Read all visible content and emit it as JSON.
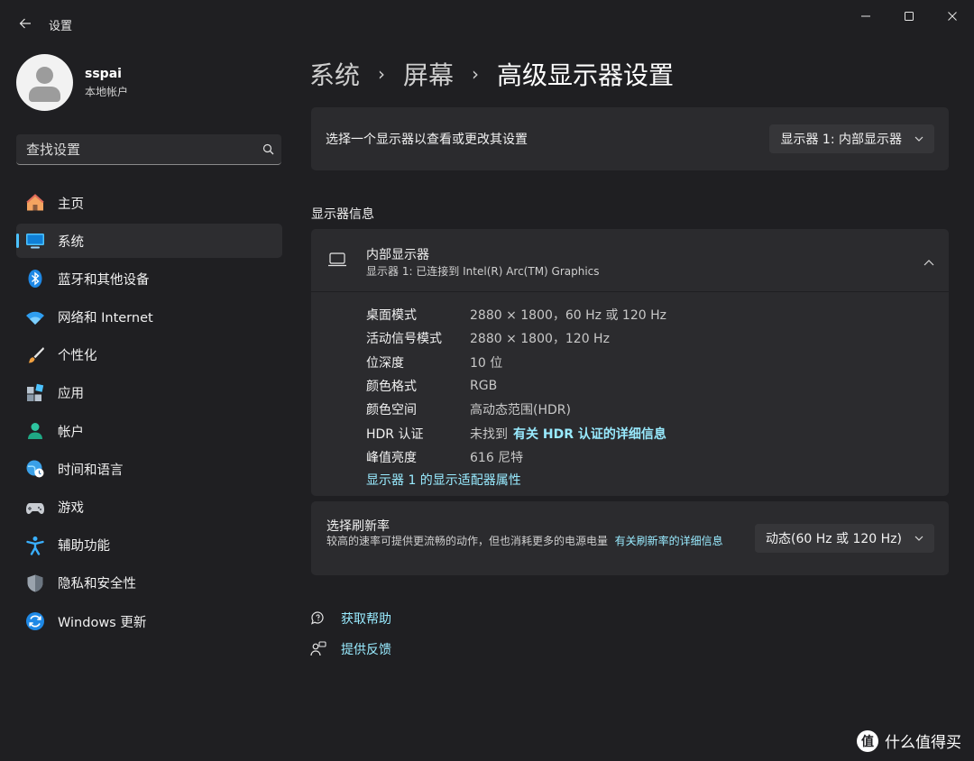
{
  "window": {
    "title": "设置"
  },
  "profile": {
    "name": "sspai",
    "account_type": "本地帐户"
  },
  "search": {
    "placeholder": "查找设置"
  },
  "sidebar": {
    "items": [
      {
        "label": "主页",
        "icon": "home-icon",
        "active": false
      },
      {
        "label": "系统",
        "icon": "system-icon",
        "active": true
      },
      {
        "label": "蓝牙和其他设备",
        "icon": "bluetooth-icon",
        "active": false
      },
      {
        "label": "网络和 Internet",
        "icon": "wifi-icon",
        "active": false
      },
      {
        "label": "个性化",
        "icon": "brush-icon",
        "active": false
      },
      {
        "label": "应用",
        "icon": "apps-icon",
        "active": false
      },
      {
        "label": "帐户",
        "icon": "account-icon",
        "active": false
      },
      {
        "label": "时间和语言",
        "icon": "globe-clock-icon",
        "active": false
      },
      {
        "label": "游戏",
        "icon": "gamepad-icon",
        "active": false
      },
      {
        "label": "辅助功能",
        "icon": "accessibility-icon",
        "active": false
      },
      {
        "label": "隐私和安全性",
        "icon": "shield-icon",
        "active": false
      },
      {
        "label": "Windows 更新",
        "icon": "update-icon",
        "active": false
      }
    ]
  },
  "breadcrumb": {
    "items": [
      "系统",
      "屏幕",
      "高级显示器设置"
    ]
  },
  "display_select": {
    "label": "选择一个显示器以查看或更改其设置",
    "value": "显示器 1: 内部显示器"
  },
  "display_info": {
    "section_title": "显示器信息",
    "title": "内部显示器",
    "subtitle": "显示器 1: 已连接到 Intel(R) Arc(TM) Graphics",
    "rows": [
      {
        "key": "桌面模式",
        "value": "2880 × 1800，60 Hz 或 120 Hz"
      },
      {
        "key": "活动信号模式",
        "value": "2880 × 1800，120 Hz"
      },
      {
        "key": "位深度",
        "value": "10 位"
      },
      {
        "key": "颜色格式",
        "value": "RGB"
      },
      {
        "key": "颜色空间",
        "value": "高动态范围(HDR)"
      },
      {
        "key": "HDR 认证",
        "value": "未找到",
        "link": "有关 HDR 认证的详细信息"
      },
      {
        "key": "峰值亮度",
        "value": "616 尼特"
      }
    ],
    "adapter_link": "显示器 1 的显示适配器属性"
  },
  "refresh": {
    "title": "选择刷新率",
    "description": "较高的速率可提供更流畅的动作，但也消耗更多的电源电量",
    "link": "有关刷新率的详细信息",
    "value": "动态(60 Hz 或 120 Hz)"
  },
  "help": {
    "get_help": "获取帮助",
    "feedback": "提供反馈"
  },
  "watermark": {
    "logo": "值",
    "text": "什么值得买"
  },
  "colors": {
    "accent": "#4cc2ff",
    "link": "#99ebff",
    "background": "#1f1f22",
    "card": "#2b2b2e"
  }
}
